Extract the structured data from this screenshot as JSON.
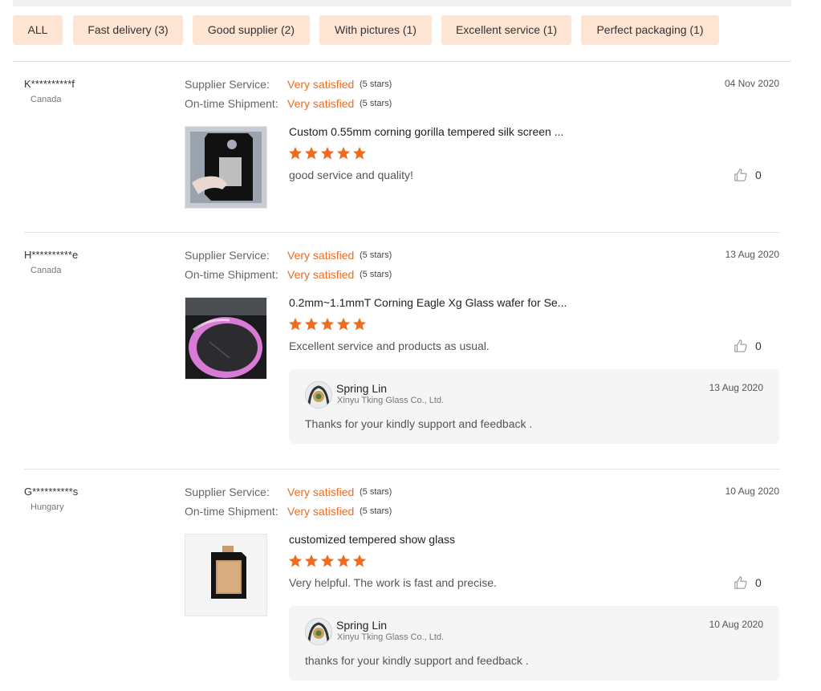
{
  "filters": [
    {
      "label": "ALL"
    },
    {
      "label": "Fast delivery (3)"
    },
    {
      "label": "Good supplier (2)"
    },
    {
      "label": "With pictures (1)"
    },
    {
      "label": "Excellent service (1)"
    },
    {
      "label": "Perfect packaging (1)"
    }
  ],
  "labels": {
    "supplier_service": "Supplier Service:",
    "ontime_shipment": "On-time Shipment:"
  },
  "colors": {
    "accent": "#f06b1d",
    "chip_bg": "#fde4d3",
    "reply_bg": "#f5f5f6",
    "star": "#f06b1d"
  },
  "reviews": [
    {
      "user": "K**********f",
      "country": "Canada",
      "date": "04 Nov 2020",
      "supplier_service": "Very satisfied",
      "supplier_service_stars": "(5 stars)",
      "ontime_shipment": "Very satisfied",
      "ontime_shipment_stars": "(5 stars)",
      "product_title": "Custom 0.55mm corning gorilla tempered silk screen ...",
      "rating": 5,
      "comment": "good service and quality!",
      "likes": "0"
    },
    {
      "user": "H**********e",
      "country": "Canada",
      "date": "13 Aug 2020",
      "supplier_service": "Very satisfied",
      "supplier_service_stars": "(5 stars)",
      "ontime_shipment": "Very satisfied",
      "ontime_shipment_stars": "(5 stars)",
      "product_title": "0.2mm~1.1mmT Corning Eagle Xg Glass wafer for Se...",
      "rating": 5,
      "comment": "Excellent service and products as usual.",
      "likes": "0",
      "reply": {
        "name": "Spring Lin",
        "company": "Xinyu Tking Glass Co., Ltd.",
        "date": "13 Aug 2020",
        "text": "Thanks for your kindly support and feedback ."
      }
    },
    {
      "user": "G**********s",
      "country": "Hungary",
      "date": "10 Aug 2020",
      "supplier_service": "Very satisfied",
      "supplier_service_stars": "(5 stars)",
      "ontime_shipment": "Very satisfied",
      "ontime_shipment_stars": "(5 stars)",
      "product_title": "customized tempered show glass",
      "rating": 5,
      "comment": "Very helpful. The work is fast and precise.",
      "likes": "0",
      "reply": {
        "name": "Spring Lin",
        "company": "Xinyu Tking Glass Co., Ltd.",
        "date": "10 Aug 2020",
        "text": "thanks for your kindly support and feedback ."
      }
    }
  ]
}
